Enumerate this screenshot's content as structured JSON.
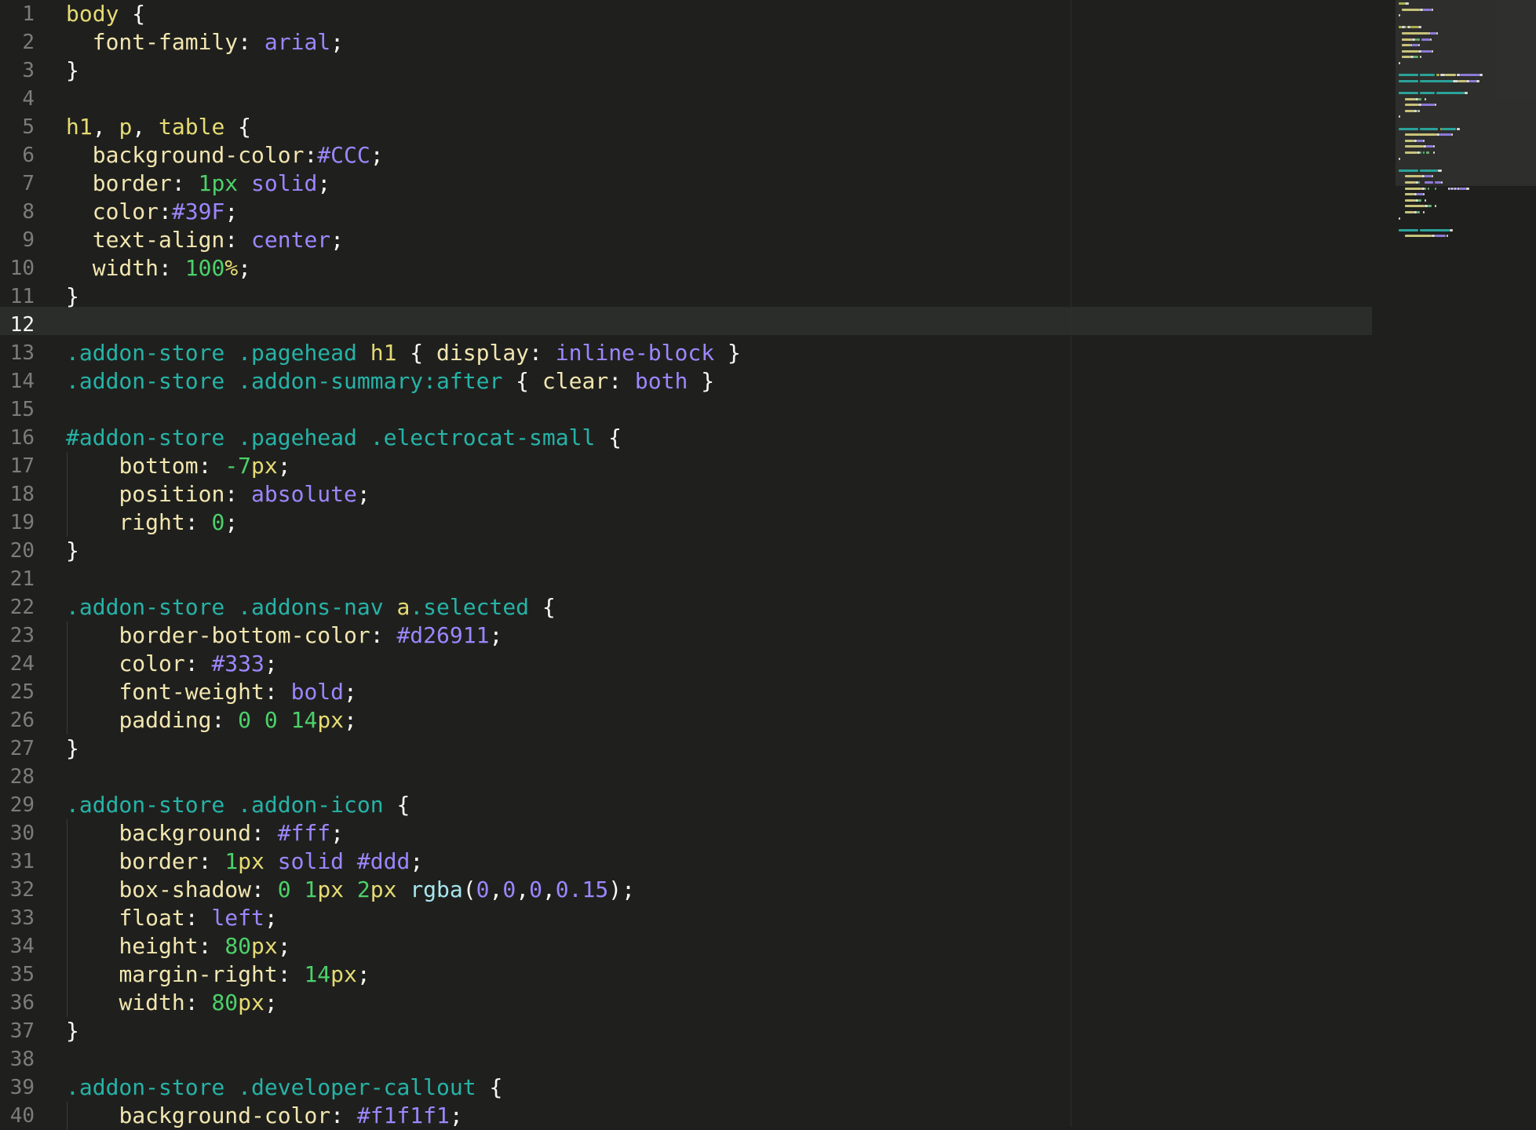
{
  "editor": {
    "current_line": 12,
    "lines": [
      {
        "n": "1",
        "indent": 0,
        "tokens": [
          {
            "t": "body",
            "c": "sel"
          },
          {
            "t": " {",
            "c": "pun"
          }
        ]
      },
      {
        "n": "2",
        "indent": 1,
        "tokens": [
          {
            "t": "font-family",
            "c": "prop"
          },
          {
            "t": ": ",
            "c": "pun"
          },
          {
            "t": "arial",
            "c": "val"
          },
          {
            "t": ";",
            "c": "pun"
          }
        ]
      },
      {
        "n": "3",
        "indent": 0,
        "tokens": [
          {
            "t": "}",
            "c": "pun"
          }
        ]
      },
      {
        "n": "4",
        "indent": 0,
        "tokens": []
      },
      {
        "n": "5",
        "indent": 0,
        "tokens": [
          {
            "t": "h1",
            "c": "sel"
          },
          {
            "t": ", ",
            "c": "pun"
          },
          {
            "t": "p",
            "c": "sel"
          },
          {
            "t": ", ",
            "c": "pun"
          },
          {
            "t": "table",
            "c": "sel"
          },
          {
            "t": " {",
            "c": "pun"
          }
        ]
      },
      {
        "n": "6",
        "indent": 1,
        "tokens": [
          {
            "t": "background-color",
            "c": "prop"
          },
          {
            "t": ":",
            "c": "pun"
          },
          {
            "t": "#CCC",
            "c": "val"
          },
          {
            "t": ";",
            "c": "pun"
          }
        ]
      },
      {
        "n": "7",
        "indent": 1,
        "tokens": [
          {
            "t": "border",
            "c": "prop"
          },
          {
            "t": ": ",
            "c": "pun"
          },
          {
            "t": "1",
            "c": "num"
          },
          {
            "t": "px",
            "c": "num"
          },
          {
            "t": " ",
            "c": "pun"
          },
          {
            "t": "solid",
            "c": "val"
          },
          {
            "t": ";",
            "c": "pun"
          }
        ]
      },
      {
        "n": "8",
        "indent": 1,
        "tokens": [
          {
            "t": "color",
            "c": "prop"
          },
          {
            "t": ":",
            "c": "pun"
          },
          {
            "t": "#39F",
            "c": "val"
          },
          {
            "t": ";",
            "c": "pun"
          }
        ]
      },
      {
        "n": "9",
        "indent": 1,
        "tokens": [
          {
            "t": "text-align",
            "c": "prop"
          },
          {
            "t": ": ",
            "c": "pun"
          },
          {
            "t": "center",
            "c": "val"
          },
          {
            "t": ";",
            "c": "pun"
          }
        ]
      },
      {
        "n": "10",
        "indent": 1,
        "tokens": [
          {
            "t": "width",
            "c": "prop"
          },
          {
            "t": ": ",
            "c": "pun"
          },
          {
            "t": "100",
            "c": "num"
          },
          {
            "t": "%",
            "c": "unit"
          },
          {
            "t": ";",
            "c": "pun"
          }
        ]
      },
      {
        "n": "11",
        "indent": 0,
        "tokens": [
          {
            "t": "}",
            "c": "pun"
          }
        ]
      },
      {
        "n": "12",
        "indent": 0,
        "tokens": []
      },
      {
        "n": "13",
        "indent": 0,
        "tokens": [
          {
            "t": ".addon-store",
            "c": "cls"
          },
          {
            "t": " ",
            "c": "pun"
          },
          {
            "t": ".pagehead",
            "c": "cls"
          },
          {
            "t": " ",
            "c": "pun"
          },
          {
            "t": "h1",
            "c": "sel"
          },
          {
            "t": " { ",
            "c": "pun"
          },
          {
            "t": "display",
            "c": "prop"
          },
          {
            "t": ": ",
            "c": "pun"
          },
          {
            "t": "inline-block",
            "c": "val"
          },
          {
            "t": " }",
            "c": "pun"
          }
        ]
      },
      {
        "n": "14",
        "indent": 0,
        "tokens": [
          {
            "t": ".addon-store",
            "c": "cls"
          },
          {
            "t": " ",
            "c": "pun"
          },
          {
            "t": ".addon-summary:after",
            "c": "cls"
          },
          {
            "t": " { ",
            "c": "pun"
          },
          {
            "t": "clear",
            "c": "prop"
          },
          {
            "t": ": ",
            "c": "pun"
          },
          {
            "t": "both",
            "c": "val"
          },
          {
            "t": " }",
            "c": "pun"
          }
        ]
      },
      {
        "n": "15",
        "indent": 0,
        "tokens": []
      },
      {
        "n": "16",
        "indent": 0,
        "tokens": [
          {
            "t": "#addon-store",
            "c": "cls"
          },
          {
            "t": " ",
            "c": "pun"
          },
          {
            "t": ".pagehead",
            "c": "cls"
          },
          {
            "t": " ",
            "c": "pun"
          },
          {
            "t": ".electrocat-small",
            "c": "cls"
          },
          {
            "t": " {",
            "c": "pun"
          }
        ]
      },
      {
        "n": "17",
        "indent": 2,
        "tokens": [
          {
            "t": "bottom",
            "c": "prop"
          },
          {
            "t": ": ",
            "c": "pun"
          },
          {
            "t": "-7",
            "c": "num"
          },
          {
            "t": "px",
            "c": "unit"
          },
          {
            "t": ";",
            "c": "pun"
          }
        ]
      },
      {
        "n": "18",
        "indent": 2,
        "tokens": [
          {
            "t": "position",
            "c": "prop"
          },
          {
            "t": ": ",
            "c": "pun"
          },
          {
            "t": "absolute",
            "c": "val"
          },
          {
            "t": ";",
            "c": "pun"
          }
        ]
      },
      {
        "n": "19",
        "indent": 2,
        "tokens": [
          {
            "t": "right",
            "c": "prop"
          },
          {
            "t": ": ",
            "c": "pun"
          },
          {
            "t": "0",
            "c": "num"
          },
          {
            "t": ";",
            "c": "pun"
          }
        ]
      },
      {
        "n": "20",
        "indent": 0,
        "tokens": [
          {
            "t": "}",
            "c": "pun"
          }
        ]
      },
      {
        "n": "21",
        "indent": 0,
        "tokens": []
      },
      {
        "n": "22",
        "indent": 0,
        "tokens": [
          {
            "t": ".addon-store",
            "c": "cls"
          },
          {
            "t": " ",
            "c": "pun"
          },
          {
            "t": ".addons-nav",
            "c": "cls"
          },
          {
            "t": " ",
            "c": "pun"
          },
          {
            "t": "a",
            "c": "sel"
          },
          {
            "t": ".selected",
            "c": "cls"
          },
          {
            "t": " {",
            "c": "pun"
          }
        ]
      },
      {
        "n": "23",
        "indent": 2,
        "tokens": [
          {
            "t": "border-bottom-color",
            "c": "prop"
          },
          {
            "t": ": ",
            "c": "pun"
          },
          {
            "t": "#d26911",
            "c": "val"
          },
          {
            "t": ";",
            "c": "pun"
          }
        ]
      },
      {
        "n": "24",
        "indent": 2,
        "tokens": [
          {
            "t": "color",
            "c": "prop"
          },
          {
            "t": ": ",
            "c": "pun"
          },
          {
            "t": "#333",
            "c": "val"
          },
          {
            "t": ";",
            "c": "pun"
          }
        ]
      },
      {
        "n": "25",
        "indent": 2,
        "tokens": [
          {
            "t": "font-weight",
            "c": "prop"
          },
          {
            "t": ": ",
            "c": "pun"
          },
          {
            "t": "bold",
            "c": "val"
          },
          {
            "t": ";",
            "c": "pun"
          }
        ]
      },
      {
        "n": "26",
        "indent": 2,
        "tokens": [
          {
            "t": "padding",
            "c": "prop"
          },
          {
            "t": ": ",
            "c": "pun"
          },
          {
            "t": "0",
            "c": "num"
          },
          {
            "t": " ",
            "c": "pun"
          },
          {
            "t": "0",
            "c": "num"
          },
          {
            "t": " ",
            "c": "pun"
          },
          {
            "t": "14",
            "c": "num"
          },
          {
            "t": "px",
            "c": "unit"
          },
          {
            "t": ";",
            "c": "pun"
          }
        ]
      },
      {
        "n": "27",
        "indent": 0,
        "tokens": [
          {
            "t": "}",
            "c": "pun"
          }
        ]
      },
      {
        "n": "28",
        "indent": 0,
        "tokens": []
      },
      {
        "n": "29",
        "indent": 0,
        "tokens": [
          {
            "t": ".addon-store",
            "c": "cls"
          },
          {
            "t": " ",
            "c": "pun"
          },
          {
            "t": ".addon-icon",
            "c": "cls"
          },
          {
            "t": " {",
            "c": "pun"
          }
        ]
      },
      {
        "n": "30",
        "indent": 2,
        "tokens": [
          {
            "t": "background",
            "c": "prop"
          },
          {
            "t": ": ",
            "c": "pun"
          },
          {
            "t": "#fff",
            "c": "val"
          },
          {
            "t": ";",
            "c": "pun"
          }
        ]
      },
      {
        "n": "31",
        "indent": 2,
        "tokens": [
          {
            "t": "border",
            "c": "prop"
          },
          {
            "t": ": ",
            "c": "pun"
          },
          {
            "t": "1",
            "c": "num"
          },
          {
            "t": "px",
            "c": "unit"
          },
          {
            "t": " ",
            "c": "pun"
          },
          {
            "t": "solid",
            "c": "val"
          },
          {
            "t": " ",
            "c": "pun"
          },
          {
            "t": "#ddd",
            "c": "val"
          },
          {
            "t": ";",
            "c": "pun"
          }
        ]
      },
      {
        "n": "32",
        "indent": 2,
        "tokens": [
          {
            "t": "box-shadow",
            "c": "prop"
          },
          {
            "t": ": ",
            "c": "pun"
          },
          {
            "t": "0",
            "c": "num"
          },
          {
            "t": " ",
            "c": "pun"
          },
          {
            "t": "1",
            "c": "num"
          },
          {
            "t": "px",
            "c": "unit"
          },
          {
            "t": " ",
            "c": "pun"
          },
          {
            "t": "2",
            "c": "num"
          },
          {
            "t": "px",
            "c": "unit"
          },
          {
            "t": " ",
            "c": "pun"
          },
          {
            "t": "rgba",
            "c": "fn"
          },
          {
            "t": "(",
            "c": "pun"
          },
          {
            "t": "0",
            "c": "val"
          },
          {
            "t": ",",
            "c": "pun"
          },
          {
            "t": "0",
            "c": "val"
          },
          {
            "t": ",",
            "c": "pun"
          },
          {
            "t": "0",
            "c": "val"
          },
          {
            "t": ",",
            "c": "pun"
          },
          {
            "t": "0.15",
            "c": "val"
          },
          {
            "t": ");",
            "c": "pun"
          }
        ]
      },
      {
        "n": "33",
        "indent": 2,
        "tokens": [
          {
            "t": "float",
            "c": "prop"
          },
          {
            "t": ": ",
            "c": "pun"
          },
          {
            "t": "left",
            "c": "val"
          },
          {
            "t": ";",
            "c": "pun"
          }
        ]
      },
      {
        "n": "34",
        "indent": 2,
        "tokens": [
          {
            "t": "height",
            "c": "prop"
          },
          {
            "t": ": ",
            "c": "pun"
          },
          {
            "t": "80",
            "c": "num"
          },
          {
            "t": "px",
            "c": "unit"
          },
          {
            "t": ";",
            "c": "pun"
          }
        ]
      },
      {
        "n": "35",
        "indent": 2,
        "tokens": [
          {
            "t": "margin-right",
            "c": "prop"
          },
          {
            "t": ": ",
            "c": "pun"
          },
          {
            "t": "14",
            "c": "num"
          },
          {
            "t": "px",
            "c": "unit"
          },
          {
            "t": ";",
            "c": "pun"
          }
        ]
      },
      {
        "n": "36",
        "indent": 2,
        "tokens": [
          {
            "t": "width",
            "c": "prop"
          },
          {
            "t": ": ",
            "c": "pun"
          },
          {
            "t": "80",
            "c": "num"
          },
          {
            "t": "px",
            "c": "unit"
          },
          {
            "t": ";",
            "c": "pun"
          }
        ]
      },
      {
        "n": "37",
        "indent": 0,
        "tokens": [
          {
            "t": "}",
            "c": "pun"
          }
        ]
      },
      {
        "n": "38",
        "indent": 0,
        "tokens": []
      },
      {
        "n": "39",
        "indent": 0,
        "tokens": [
          {
            "t": ".addon-store",
            "c": "cls"
          },
          {
            "t": " ",
            "c": "pun"
          },
          {
            "t": ".developer-callout",
            "c": "cls"
          },
          {
            "t": " {",
            "c": "pun"
          }
        ]
      },
      {
        "n": "40",
        "indent": 2,
        "tokens": [
          {
            "t": "background-color",
            "c": "prop"
          },
          {
            "t": ": ",
            "c": "pun"
          },
          {
            "t": "#f1f1f1",
            "c": "val"
          },
          {
            "t": ";",
            "c": "pun"
          }
        ]
      }
    ]
  },
  "colors": {
    "background": "#1f201d",
    "current_line": "#2b2d2a",
    "selector": "#e6db74",
    "class": "#26b3a8",
    "property": "#f2e6b0",
    "value": "#9d86ff",
    "number": "#4cd16a",
    "line_number": "#7c7d78"
  },
  "minimap": {
    "icon": "minimap"
  }
}
